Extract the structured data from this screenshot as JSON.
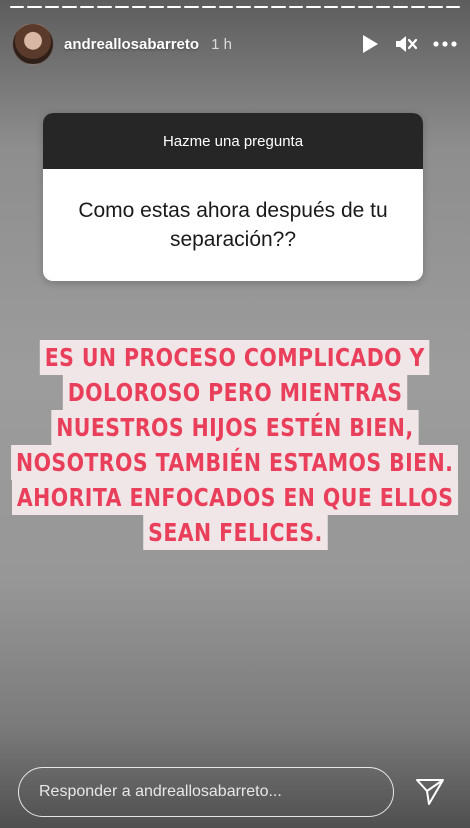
{
  "story": {
    "progress_segments": 26,
    "active_segment": 26
  },
  "header": {
    "username": "andreallosabarreto",
    "time": "1 h",
    "icons": [
      "play-icon",
      "mute-icon",
      "more-icon"
    ]
  },
  "question": {
    "title": "Hazme una pregunta",
    "text": "Como estas ahora después de tu separación??"
  },
  "answer": {
    "lines": [
      "ES UN PROCESO COMPLICADO Y",
      "DOLOROSO PERO MIENTRAS",
      "NUESTROS HIJOS ESTÉN BIEN,",
      "NOSOTROS TAMBIÉN ESTAMOS BIEN.",
      "AHORITA ENFOCADOS EN QUE ELLOS",
      "SEAN FELICES."
    ],
    "text_color": "#ea3f5b",
    "highlight_color": "#f0e6e8"
  },
  "reply": {
    "placeholder": "Responder a andreallosabarreto..."
  },
  "colors": {
    "card_header": "#262626",
    "card_body": "#ffffff"
  }
}
